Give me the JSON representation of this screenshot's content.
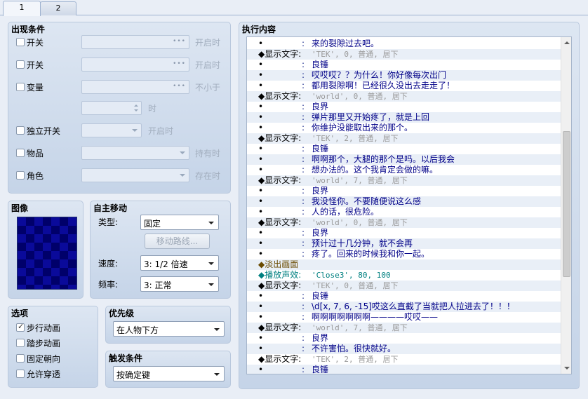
{
  "tabs": [
    {
      "label": "1"
    },
    {
      "label": "2"
    }
  ],
  "conditions": {
    "title": "出现条件",
    "switch1": {
      "label": "开关",
      "state": "开启时"
    },
    "switch2": {
      "label": "开关",
      "state": "开启时"
    },
    "variable": {
      "label": "变量",
      "state": "不小于",
      "unit": "时"
    },
    "self_switch": {
      "label": "独立开关",
      "state": "开启时"
    },
    "item": {
      "label": "物品",
      "state": "持有时"
    },
    "actor": {
      "label": "角色",
      "state": "存在时"
    }
  },
  "image": {
    "title": "图像"
  },
  "autonomous_movement": {
    "title": "自主移动",
    "type_label": "类型:",
    "type_value": "固定",
    "route_button": "移动路线...",
    "speed_label": "速度:",
    "speed_value": "3: 1/2 倍速",
    "freq_label": "频率:",
    "freq_value": "3: 正常"
  },
  "options": {
    "title": "选项",
    "items": [
      {
        "label": "步行动画",
        "checked": true
      },
      {
        "label": "踏步动画",
        "checked": false
      },
      {
        "label": "固定朝向",
        "checked": false
      },
      {
        "label": "允许穿透",
        "checked": false
      }
    ]
  },
  "priority": {
    "title": "优先级",
    "value": "在人物下方"
  },
  "trigger": {
    "title": "触发条件",
    "value": "按确定键"
  },
  "contents": {
    "title": "执行内容",
    "rows": [
      {
        "kind": "text",
        "bullet": "•",
        "colon": ":",
        "text": "来的裂隙过去吧。"
      },
      {
        "kind": "show",
        "cmd": "◆显示文字:",
        "detail": "'TEK', 0, 普通, 居下"
      },
      {
        "kind": "text",
        "bullet": "•",
        "colon": ":",
        "text": "良锤"
      },
      {
        "kind": "text",
        "bullet": "•",
        "colon": ":",
        "text": "哎哎哎？？为什么！你好像每次出门"
      },
      {
        "kind": "text",
        "bullet": "•",
        "colon": ":",
        "text": "都用裂隙啊！已经很久没出去走走了！"
      },
      {
        "kind": "show",
        "cmd": "◆显示文字:",
        "detail": "'world', 0, 普通, 居下"
      },
      {
        "kind": "text",
        "bullet": "•",
        "colon": ":",
        "text": "良界"
      },
      {
        "kind": "text",
        "bullet": "•",
        "colon": ":",
        "text": "弹片那里又开始疼了，就是上回"
      },
      {
        "kind": "text",
        "bullet": "•",
        "colon": ":",
        "text": "你维护没能取出来的那个。"
      },
      {
        "kind": "show",
        "cmd": "◆显示文字:",
        "detail": "'TEK', 2, 普通, 居下"
      },
      {
        "kind": "text",
        "bullet": "•",
        "colon": ":",
        "text": "良锤"
      },
      {
        "kind": "text",
        "bullet": "•",
        "colon": ":",
        "text": "啊啊那个，大腿的那个是吗。以后我会"
      },
      {
        "kind": "text",
        "bullet": "•",
        "colon": ":",
        "text": "想办法的。这个我肯定会做的嘛。"
      },
      {
        "kind": "show",
        "cmd": "◆显示文字:",
        "detail": "'world', 7, 普通, 居下"
      },
      {
        "kind": "text",
        "bullet": "•",
        "colon": ":",
        "text": "良界"
      },
      {
        "kind": "text",
        "bullet": "•",
        "colon": ":",
        "text": "我没怪你。不要随便说这么感"
      },
      {
        "kind": "text",
        "bullet": "•",
        "colon": ":",
        "text": "人的话，很危险。"
      },
      {
        "kind": "show",
        "cmd": "◆显示文字:",
        "detail": "'world', 0, 普通, 居下"
      },
      {
        "kind": "text",
        "bullet": "•",
        "colon": ":",
        "text": "良界"
      },
      {
        "kind": "text",
        "bullet": "•",
        "colon": ":",
        "text": "预计过十几分钟，就不会再"
      },
      {
        "kind": "text",
        "bullet": "•",
        "colon": ":",
        "text": "疼了。回来的时候我和你一起。"
      },
      {
        "kind": "fade",
        "cmd": "◆淡出画面",
        "detail": ""
      },
      {
        "kind": "se",
        "cmd": "◆播放声效:",
        "detail": "'Close3', 80, 100"
      },
      {
        "kind": "show",
        "cmd": "◆显示文字:",
        "detail": "'TEK', 0, 普通, 居下"
      },
      {
        "kind": "text",
        "bullet": "•",
        "colon": ":",
        "text": "良锤"
      },
      {
        "kind": "text",
        "bullet": "•",
        "colon": ":",
        "text": "\\d[x, 7, 6, -15]哎这么直截了当就把人拉进去了！！！"
      },
      {
        "kind": "text",
        "bullet": "•",
        "colon": ":",
        "text": "啊啊啊啊啊啊啊————哎哎——"
      },
      {
        "kind": "show",
        "cmd": "◆显示文字:",
        "detail": "'world', 7, 普通, 居下"
      },
      {
        "kind": "text",
        "bullet": "•",
        "colon": ":",
        "text": "良界"
      },
      {
        "kind": "text",
        "bullet": "•",
        "colon": ":",
        "text": "不许害怕。很快就好。"
      },
      {
        "kind": "show",
        "cmd": "◆显示文字:",
        "detail": "'TEK', 2, 普通, 居下"
      },
      {
        "kind": "text",
        "bullet": "•",
        "colon": ":",
        "text": "良锤"
      }
    ]
  },
  "colors": {
    "accent": "#1a2a8c",
    "se_command": "#008080",
    "fade_command": "#6a4a00",
    "panel": "#c5d4e8"
  }
}
